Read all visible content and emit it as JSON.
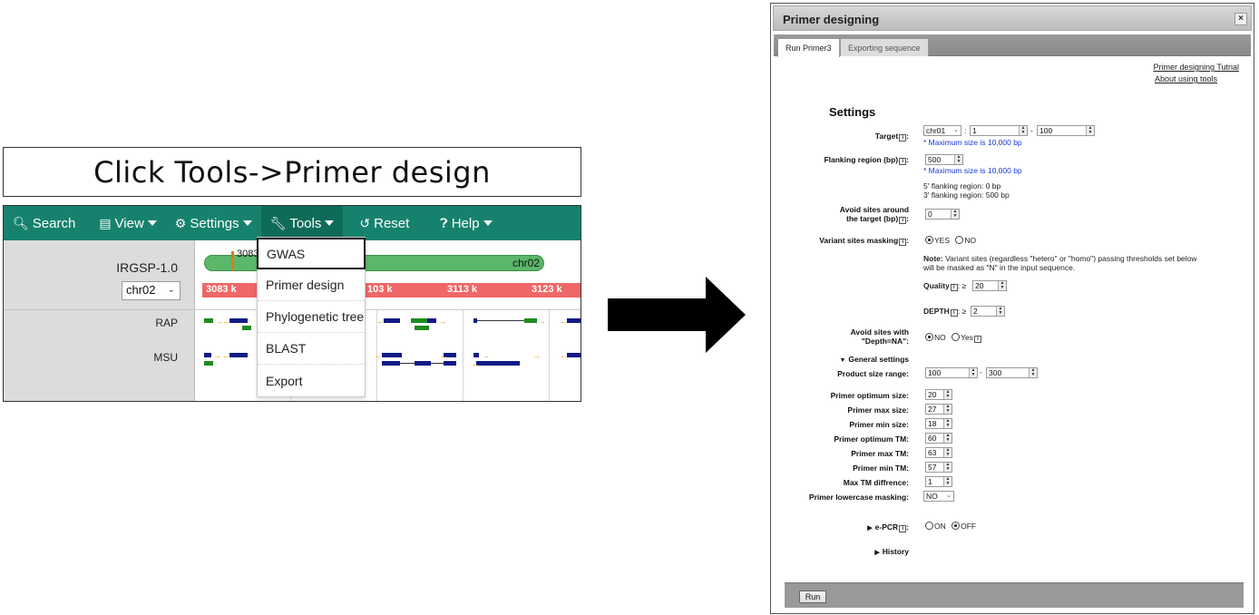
{
  "instruction": "Click Tools->Primer design",
  "toolbar": {
    "search": "Search",
    "view": "View",
    "settings": "Settings",
    "tools": "Tools",
    "reset": "Reset",
    "help": "Help"
  },
  "browser": {
    "genome": "IRGSP-1.0",
    "chromosome_select": "chr02",
    "chromosome_name": "chr02",
    "position_label": "3083",
    "ruler_ticks": [
      "3083 k",
      "103 k",
      "3113 k",
      "3123 k"
    ],
    "tracks": [
      "RAP",
      "MSU"
    ]
  },
  "tools_menu": [
    "GWAS",
    "Primer design",
    "Phylogenetic tree",
    "BLAST",
    "Export"
  ],
  "dialog": {
    "title": "Primer designing",
    "close": "×",
    "tabs": [
      "Run Primer3",
      "Exporting sequence"
    ],
    "links": [
      "Primer designing Tutrial",
      "About using tools"
    ],
    "settings_heading": "Settings",
    "target": {
      "label": "Target",
      "chr": "chr01",
      "start": "1",
      "sep": "-",
      "end": "100",
      "note": "* Maximum size is 10,000 bp"
    },
    "flanking": {
      "label": "Flanking region (bp)",
      "value": "500",
      "note": "* Maximum size is 10,000 bp",
      "five_prime": "5' flanking  region:  0 bp",
      "three_prime": "3' flanking  region:  500 bp"
    },
    "avoid_sites": {
      "label_line1": "Avoid sites around",
      "label_line2": "the target (bp)",
      "value": "0"
    },
    "variant_masking": {
      "label": "Variant sites masking",
      "yes": "YES",
      "no": "NO",
      "note_bold": "Note:",
      "note_line1": " Variant sites (regardless \"hetero\" or \"homo\") passing thresholds set below",
      "note_line2": "will be masked as \"N\" in the input sequence.",
      "quality_label": "Quality",
      "quality_value": "20",
      "depth_label": "DEPTH",
      "depth_value": "2",
      "ge": ": ≥"
    },
    "avoid_na": {
      "label_line1": "Avoid sites with",
      "label_line2": "\"Depth=NA\":",
      "no": "NO",
      "yes": "Yes"
    },
    "general_settings": "General settings",
    "product_size": {
      "label": "Product size range:",
      "min": "100",
      "sep": "-",
      "max": "300"
    },
    "primer_params": [
      {
        "label": "Primer optimum size:",
        "value": "20"
      },
      {
        "label": "Primer max size:",
        "value": "27"
      },
      {
        "label": "Primer min size:",
        "value": "18"
      },
      {
        "label": "Primer optimum TM:",
        "value": "60"
      },
      {
        "label": "Primer max TM:",
        "value": "63"
      },
      {
        "label": "Primer min TM:",
        "value": "57"
      },
      {
        "label": "Max TM diffrence:",
        "value": "1"
      }
    ],
    "lowercase_masking": {
      "label": "Primer lowercase masking:",
      "value": "NO"
    },
    "epcr": {
      "label": "e-PCR",
      "on": "ON",
      "off": "OFF"
    },
    "history": "History",
    "run": "Run"
  },
  "colors": {
    "toolbar": "#16826e",
    "chromosome_bar": "#5bb76a",
    "ruler": "#ef6767",
    "gene_blue": "#101a86",
    "gene_green": "#1f8c1f",
    "link_note": "#1a3ad6"
  }
}
